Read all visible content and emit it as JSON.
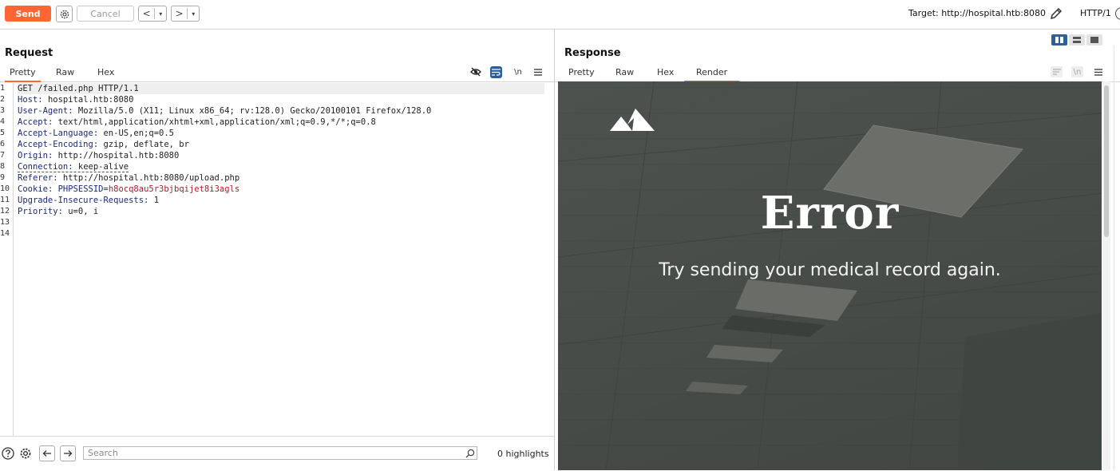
{
  "toolbar": {
    "send_label": "Send",
    "cancel_label": "Cancel",
    "back_glyph": "<",
    "forward_glyph": ">",
    "dropdown_glyph": "▾",
    "target_label": "Target: http://hospital.htb:8080",
    "http_version": "HTTP/1"
  },
  "request": {
    "title": "Request",
    "tabs": [
      "Pretty",
      "Raw",
      "Hex"
    ],
    "active_tab": "Pretty",
    "tool_newline": "\\n",
    "line_numbers": [
      "1",
      "2",
      "3",
      "4",
      "5",
      "6",
      "7",
      "8",
      "9",
      "10",
      "11",
      "12",
      "13",
      "14"
    ],
    "lines": [
      {
        "text": "GET /failed.php HTTP/1.1"
      },
      {
        "key": "Host",
        "value": " hospital.htb:8080"
      },
      {
        "key": "User-Agent",
        "value": " Mozilla/5.0 (X11; Linux x86_64; rv:128.0) Gecko/20100101 Firefox/128.0"
      },
      {
        "key": "Accept",
        "value": " text/html,application/xhtml+xml,application/xml;q=0.9,*/*;q=0.8"
      },
      {
        "key": "Accept-Language",
        "value": " en-US,en;q=0.5"
      },
      {
        "key": "Accept-Encoding",
        "value": " gzip, deflate, br"
      },
      {
        "key": "Origin",
        "value": " http://hospital.htb:8080"
      },
      {
        "key": "Connection",
        "value": " keep-alive"
      },
      {
        "key": "Referer",
        "value": " http://hospital.htb:8080/upload.php"
      },
      {
        "key": "Cookie",
        "value": " PHPSESSID=",
        "cookie": "h8ocq8au5r3bjbqijet8i3agls"
      },
      {
        "key": "Upgrade-Insecure-Requests",
        "value": " 1"
      },
      {
        "key": "Priority",
        "value": " u=0, i"
      },
      {
        "text": ""
      },
      {
        "text": ""
      }
    ]
  },
  "search": {
    "placeholder": "Search",
    "highlights": "0 highlights"
  },
  "response": {
    "title": "Response",
    "tabs": [
      "Pretty",
      "Raw",
      "Hex",
      "Render"
    ],
    "active_tab": "Render",
    "tool_newline": "\\n",
    "render": {
      "heading": "Error",
      "message": "Try sending your medical record again."
    }
  },
  "colors": {
    "accent": "#ff6633",
    "layout_active": "#2d5f99"
  }
}
